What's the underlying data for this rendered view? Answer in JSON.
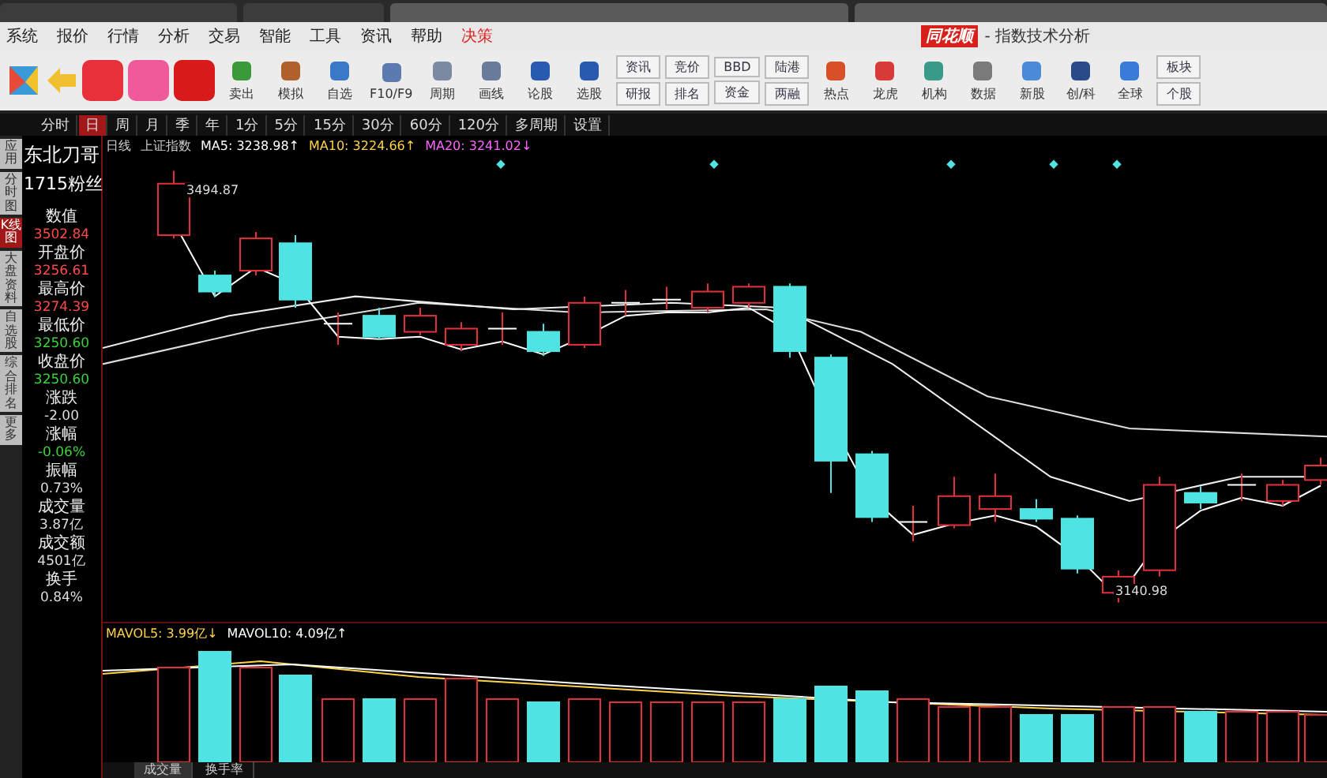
{
  "menu": [
    {
      "label": "系统",
      "highlight": false
    },
    {
      "label": "报价",
      "highlight": false
    },
    {
      "label": "行情",
      "highlight": false
    },
    {
      "label": "分析",
      "highlight": false
    },
    {
      "label": "交易",
      "highlight": false
    },
    {
      "label": "智能",
      "highlight": false
    },
    {
      "label": "工具",
      "highlight": false
    },
    {
      "label": "资讯",
      "highlight": false
    },
    {
      "label": "帮助",
      "highlight": false
    },
    {
      "label": "决策",
      "highlight": true
    }
  ],
  "app_title": {
    "logo": "同花顺",
    "subtitle": "- 指数技术分析"
  },
  "toolbar": [
    {
      "kind": "icon",
      "label": "卖出",
      "color": "#3a9a3a"
    },
    {
      "kind": "icon",
      "label": "模拟",
      "color": "#b0602a"
    },
    {
      "kind": "icon",
      "label": "自选",
      "color": "#3a78c8"
    },
    {
      "kind": "icon",
      "label": "F10/F9",
      "color": "#5a7ab0"
    },
    {
      "kind": "icon",
      "label": "周期",
      "color": "#7a8aa0"
    },
    {
      "kind": "icon",
      "label": "画线",
      "color": "#6a7a9a"
    },
    {
      "kind": "icon",
      "label": "论股",
      "color": "#2a5ab0"
    },
    {
      "kind": "icon",
      "label": "选股",
      "color": "#2a5ab0"
    },
    {
      "kind": "pair",
      "top": "资讯",
      "bottom": "研报"
    },
    {
      "kind": "pair",
      "top": "竞价",
      "bottom": "排名"
    },
    {
      "kind": "pair",
      "top": "BBD",
      "bottom": "资金"
    },
    {
      "kind": "pair",
      "top": "陆港",
      "bottom": "两融"
    },
    {
      "kind": "icon",
      "label": "热点",
      "color": "#d8502a"
    },
    {
      "kind": "icon",
      "label": "龙虎",
      "color": "#d83a3a"
    },
    {
      "kind": "icon",
      "label": "机构",
      "color": "#3a9a8a"
    },
    {
      "kind": "icon",
      "label": "数据",
      "color": "#7a7a7a"
    },
    {
      "kind": "icon",
      "label": "新股",
      "color": "#4a8ad8"
    },
    {
      "kind": "icon",
      "label": "创/科",
      "color": "#2a4a8a"
    },
    {
      "kind": "icon",
      "label": "全球",
      "color": "#3a7ad8"
    },
    {
      "kind": "pair",
      "top": "板块",
      "bottom": "个股"
    }
  ],
  "periods": [
    {
      "label": "分时",
      "selected": false
    },
    {
      "label": "日",
      "selected": true
    },
    {
      "label": "周",
      "selected": false
    },
    {
      "label": "月",
      "selected": false
    },
    {
      "label": "季",
      "selected": false
    },
    {
      "label": "年",
      "selected": false
    },
    {
      "label": "1分",
      "selected": false
    },
    {
      "label": "5分",
      "selected": false
    },
    {
      "label": "15分",
      "selected": false
    },
    {
      "label": "30分",
      "selected": false
    },
    {
      "label": "60分",
      "selected": false
    },
    {
      "label": "120分",
      "selected": false
    },
    {
      "label": "多周期",
      "selected": false
    },
    {
      "label": "设置",
      "selected": false
    }
  ],
  "side_tabs": [
    {
      "label": "应用",
      "selected": false
    },
    {
      "label": "分时图",
      "selected": false
    },
    {
      "label": "K线图",
      "selected": true
    },
    {
      "label": "大盘资料",
      "selected": false
    },
    {
      "label": "自选股",
      "selected": false
    },
    {
      "label": "综合排名",
      "selected": false
    },
    {
      "label": "更多",
      "selected": false
    }
  ],
  "overlay": {
    "name": "东北刀哥",
    "fans": "1715粉丝"
  },
  "quote": [
    {
      "label": "数值",
      "value": "3502.84",
      "color": "#ff4a4a"
    },
    {
      "label": "开盘价",
      "value": "3256.61",
      "color": "#ff4a4a"
    },
    {
      "label": "最高价",
      "value": "3274.39",
      "color": "#ff4a4a"
    },
    {
      "label": "最低价",
      "value": "3250.60",
      "color": "#3ad23a"
    },
    {
      "label": "收盘价",
      "value": "3250.60",
      "color": "#3ad23a"
    },
    {
      "label": "涨跌",
      "value": "-2.00",
      "color": "#dddddd"
    },
    {
      "label": "涨幅",
      "value": "-0.06%",
      "color": "#3ad23a"
    },
    {
      "label": "振幅",
      "value": "0.73%",
      "color": "#dddddd"
    },
    {
      "label": "成交量",
      "value": "3.87亿",
      "color": "#dddddd"
    },
    {
      "label": "成交额",
      "value": "4501亿",
      "color": "#dddddd"
    },
    {
      "label": "换手",
      "value": "0.84%",
      "color": "#dddddd"
    }
  ],
  "chart_header": {
    "period": "日线",
    "index": "上证指数",
    "ma": [
      {
        "label": "MA5: 3238.98↑",
        "color": "#ffffff"
      },
      {
        "label": "MA10: 3224.66↑",
        "color": "#ffd24a"
      },
      {
        "label": "MA20: 3241.02↓",
        "color": "#ff66ff"
      }
    ]
  },
  "price_marks": {
    "high": "3494.87",
    "low": "3140.98"
  },
  "volume_header": {
    "ma": [
      {
        "label": "MAVOL5: 3.99亿↓",
        "color": "#ffd24a"
      },
      {
        "label": "MAVOL10: 4.09亿↑",
        "color": "#ffffff"
      }
    ]
  },
  "bottom_tabs": [
    {
      "label": "成交量",
      "selected": true
    },
    {
      "label": "换手率",
      "selected": false
    }
  ]
}
